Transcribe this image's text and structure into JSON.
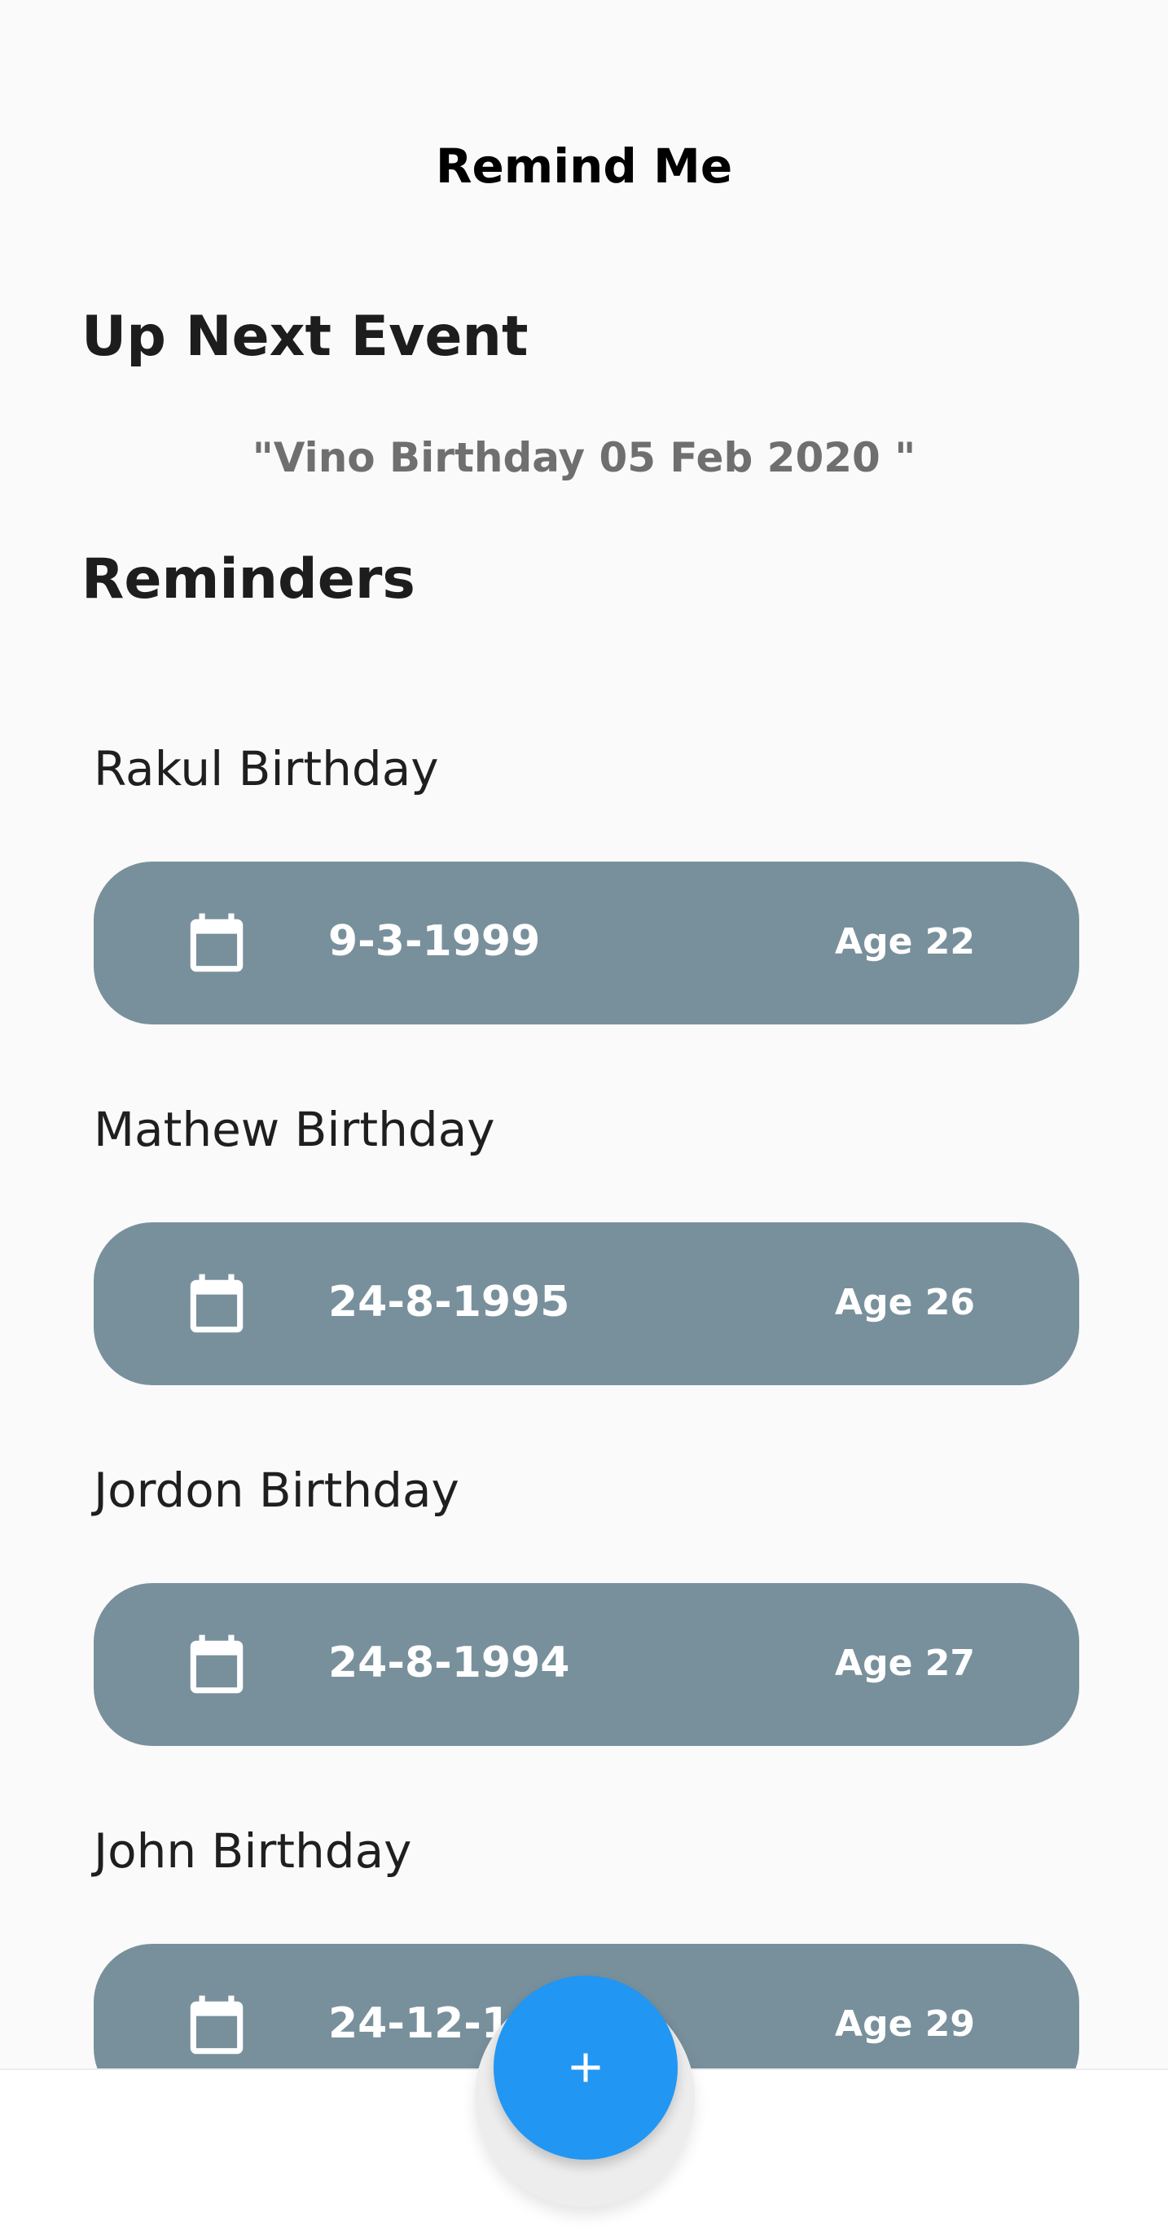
{
  "app": {
    "title": "Remind Me"
  },
  "up_next": {
    "heading": "Up Next Event",
    "value": "\"Vino Birthday 05 Feb 2020 \""
  },
  "reminders": {
    "heading": "Reminders",
    "items": [
      {
        "name": "Rakul Birthday",
        "date": "9-3-1999",
        "age": "Age 22",
        "icon": "calendar-icon"
      },
      {
        "name": "Mathew Birthday",
        "date": "24-8-1995",
        "age": "Age 26",
        "icon": "calendar-icon"
      },
      {
        "name": "Jordon Birthday",
        "date": "24-8-1994",
        "age": "Age 27",
        "icon": "calendar-icon"
      },
      {
        "name": "John Birthday",
        "date": "24-12-1992",
        "age": "Age 29",
        "icon": "calendar-icon"
      }
    ]
  },
  "fab": {
    "icon": "add-icon"
  },
  "colors": {
    "background": "#fafafa",
    "card": "#78909c",
    "accent": "#2196f3",
    "text_primary": "#000000",
    "text_secondary": "#6f6f6f",
    "card_text": "#ffffff"
  }
}
